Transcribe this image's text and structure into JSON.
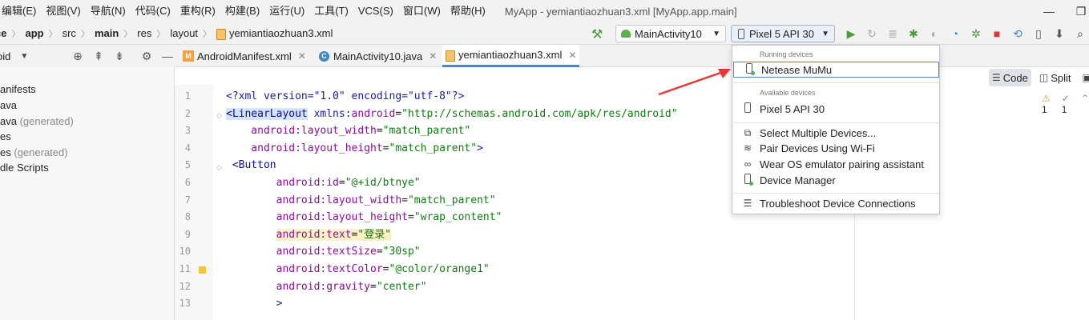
{
  "menubar": {
    "items": [
      "编辑(E)",
      "视图(V)",
      "导航(N)",
      "代码(C)",
      "重构(R)",
      "构建(B)",
      "运行(U)",
      "工具(T)",
      "VCS(S)",
      "窗口(W)",
      "帮助(H)"
    ],
    "window_title": "MyApp - yemiantiaozhuan3.xml [MyApp.app.main]",
    "minimize": "—",
    "restore": "❐"
  },
  "breadcrumb": [
    "ce",
    "app",
    "src",
    "main",
    "res",
    "layout",
    "yemiantiaozhuan3.xml"
  ],
  "toolbar": {
    "run_config": "MainActivity10",
    "device": "Pixel 5 API 30"
  },
  "project_panel": {
    "title": "oid",
    "tree": [
      {
        "label": "anifests",
        "suffix": ""
      },
      {
        "label": "ava",
        "suffix": ""
      },
      {
        "label": "ava",
        "suffix": "(generated)"
      },
      {
        "label": "es",
        "suffix": ""
      },
      {
        "label": "es",
        "suffix": "(generated)"
      },
      {
        "label": "dle Scripts",
        "suffix": ""
      }
    ]
  },
  "tabs": [
    {
      "label": "AndroidManifest.xml"
    },
    {
      "label": "MainActivity10.java"
    },
    {
      "label": "yemiantiaozhuan3.xml"
    }
  ],
  "view_modes": {
    "code": "Code",
    "split": "Split"
  },
  "inspections": {
    "warnings": "1",
    "weak": "1"
  },
  "editor": {
    "line_numbers": [
      "1",
      "2",
      "3",
      "4",
      "5",
      "6",
      "7",
      "8",
      "9",
      "10",
      "11",
      "12",
      "13"
    ],
    "lines": [
      [
        {
          "t": "<?xml version=\"1.0\" encoding=\"utf-8\"?>",
          "c": "k"
        }
      ],
      [
        {
          "t": "<LinearLayout",
          "c": "tag hl"
        },
        {
          "t": " xmlns:",
          "c": "k"
        },
        {
          "t": "android",
          "c": "attr"
        },
        {
          "t": "=",
          "c": ""
        },
        {
          "t": "\"http://schemas.android.com/apk/res/android\"",
          "c": "val"
        }
      ],
      [
        {
          "t": "    android:layout_width",
          "c": "attr"
        },
        {
          "t": "=",
          "c": ""
        },
        {
          "t": "\"match_parent\"",
          "c": "val"
        }
      ],
      [
        {
          "t": "    android:layout_height",
          "c": "attr"
        },
        {
          "t": "=",
          "c": ""
        },
        {
          "t": "\"match_parent\"",
          "c": "val"
        },
        {
          "t": ">",
          "c": "k"
        }
      ],
      [
        {
          "t": " <Button",
          "c": "tag"
        }
      ],
      [
        {
          "t": "        android:id",
          "c": "attr"
        },
        {
          "t": "=",
          "c": ""
        },
        {
          "t": "\"@+id/btnye\"",
          "c": "val"
        }
      ],
      [
        {
          "t": "        android:layout_width",
          "c": "attr"
        },
        {
          "t": "=",
          "c": ""
        },
        {
          "t": "\"match_parent\"",
          "c": "val"
        }
      ],
      [
        {
          "t": "        android:layout_height",
          "c": "attr"
        },
        {
          "t": "=",
          "c": ""
        },
        {
          "t": "\"wrap_content\"",
          "c": "val"
        }
      ],
      [
        {
          "t": "        ",
          "c": ""
        },
        {
          "t": "android:text",
          "c": "attr yel"
        },
        {
          "t": "=",
          "c": "yel"
        },
        {
          "t": "\"登录\"",
          "c": "val yel"
        }
      ],
      [
        {
          "t": "        android:textSize",
          "c": "attr"
        },
        {
          "t": "=",
          "c": ""
        },
        {
          "t": "\"30sp\"",
          "c": "val"
        }
      ],
      [
        {
          "t": "        android:textColor",
          "c": "attr"
        },
        {
          "t": "=",
          "c": ""
        },
        {
          "t": "\"@color/orange1\"",
          "c": "val"
        }
      ],
      [
        {
          "t": "        android:gravity",
          "c": "attr"
        },
        {
          "t": "=",
          "c": ""
        },
        {
          "t": "\"center\"",
          "c": "val"
        }
      ],
      [
        {
          "t": "        >",
          "c": "k"
        }
      ]
    ]
  },
  "device_popup": {
    "running_header": "Running devices",
    "running": "Netease MuMu",
    "available_header": "Available devices",
    "available": "Pixel 5 API 30",
    "actions": [
      {
        "label": "Select Multiple Devices...",
        "icon": "multi-device-icon"
      },
      {
        "label": "Pair Devices Using Wi-Fi",
        "icon": "wifi-icon"
      },
      {
        "label": "Wear OS emulator pairing assistant",
        "icon": "link-icon"
      },
      {
        "label": "Device Manager",
        "icon": "device-manager-icon"
      }
    ],
    "troubleshoot": "Troubleshoot Device Connections"
  },
  "colors": {
    "accent": "#4a88c7",
    "annotation": "#e53935",
    "run_green": "#4a9b3e"
  }
}
